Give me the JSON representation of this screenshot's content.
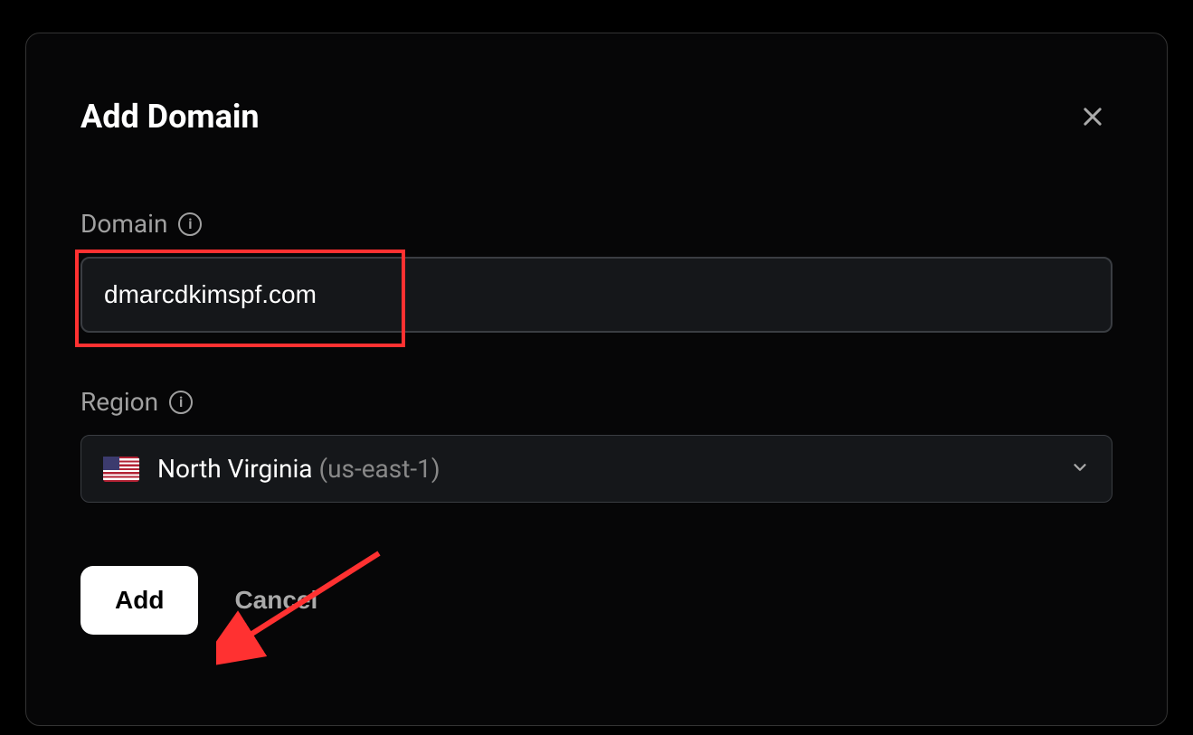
{
  "modal": {
    "title": "Add Domain",
    "fields": {
      "domain": {
        "label": "Domain",
        "value": "dmarcdkimspf.com"
      },
      "region": {
        "label": "Region",
        "selected_name": "North Virginia",
        "selected_code": "(us-east-1)",
        "flag": "us"
      }
    },
    "actions": {
      "add": "Add",
      "cancel": "Cancel"
    }
  }
}
